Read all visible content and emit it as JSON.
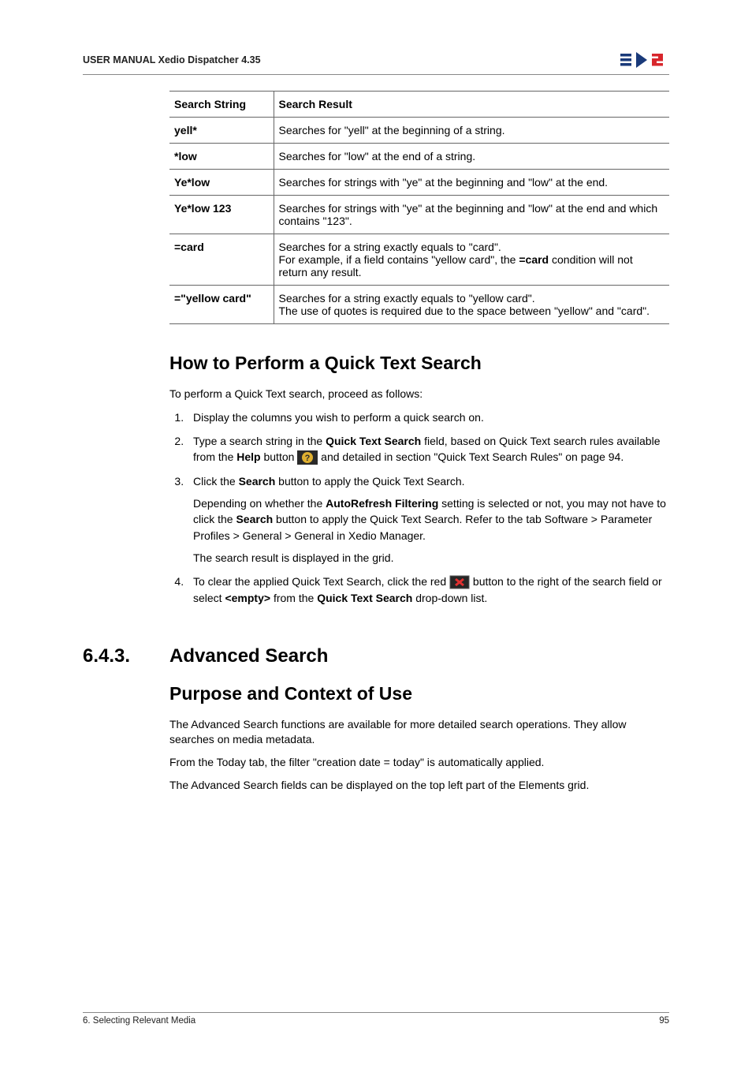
{
  "header": {
    "title": "USER MANUAL Xedio Dispatcher 4.35"
  },
  "table": {
    "hdr": {
      "c1": "Search String",
      "c2": "Search Result"
    },
    "rows": [
      {
        "c1": "yell*",
        "c2": "Searches for \"yell\" at the beginning of a string."
      },
      {
        "c1": "*low",
        "c2": "Searches for \"low\" at the end of a string."
      },
      {
        "c1": "Ye*low",
        "c2": "Searches for strings with \"ye\" at the beginning and \"low\" at the end."
      },
      {
        "c1": "Ye*low 123",
        "c2": "Searches for strings with \"ye\" at the beginning and \"low\" at the end and which contains \"123\"."
      },
      {
        "c1": "=card",
        "c2_a": "Searches for a string exactly equals to \"card\".",
        "c2_b": "For example, if a field contains \"yellow card\", the ",
        "c2_bold": "=card",
        "c2_c": " condition will not return any result."
      },
      {
        "c1": "=\"yellow card\"",
        "c2_a": "Searches for a string exactly equals to \"yellow card\".",
        "c2_b": "The use of quotes is required due to the space between \"yellow\" and \"card\"."
      }
    ]
  },
  "howto": {
    "title": "How to Perform a Quick Text Search",
    "intro": "To perform a Quick Text search, proceed as follows:",
    "step1": "Display the columns you wish to perform a quick search on.",
    "step2_a": "Type a search string in the ",
    "step2_b": "Quick Text Search",
    "step2_c": " field, based on Quick Text search rules available from the ",
    "step2_d": "Help",
    "step2_e": " button ",
    "step2_f": " and detailed in section \"Quick Text Search Rules\" on page 94.",
    "step3_a": "Click the ",
    "step3_b": "Search",
    "step3_c": " button to apply the Quick Text Search.",
    "step3_sub_a": "Depending on whether the ",
    "step3_sub_b": "AutoRefresh Filtering",
    "step3_sub_c": " setting is selected or not, you may not have to click the ",
    "step3_sub_d": "Search",
    "step3_sub_e": " button to apply the Quick Text Search. Refer to the tab Software > Parameter Profiles > General > General in Xedio Manager.",
    "step3_sub2": "The search result is displayed in the grid.",
    "step4_a": "To clear the applied Quick Text Search, click the red ",
    "step4_b": " button to the right of the search field or select ",
    "step4_c": "<empty>",
    "step4_d": " from the ",
    "step4_e": "Quick Text Search",
    "step4_f": " drop-down list."
  },
  "section": {
    "num": "6.4.3.",
    "title": "Advanced Search"
  },
  "purpose": {
    "title": "Purpose and Context of Use",
    "p1": "The Advanced Search functions are available for more detailed search operations. They allow searches on media metadata.",
    "p2": "From the Today tab, the filter \"creation date = today\" is automatically applied.",
    "p3": "The Advanced Search fields can be displayed on the top left part of the Elements grid."
  },
  "footer": {
    "left": "6. Selecting Relevant Media",
    "right": "95"
  }
}
